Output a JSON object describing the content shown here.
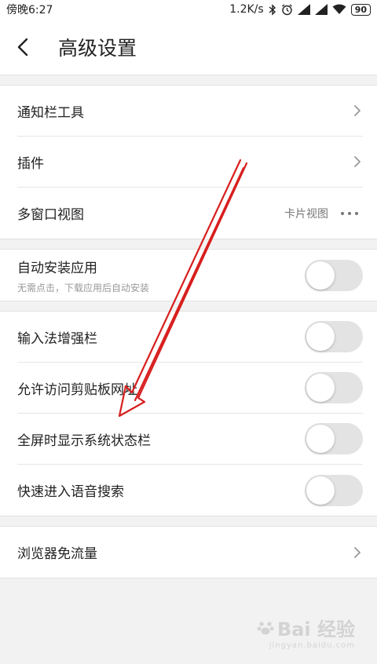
{
  "status_bar": {
    "time": "傍晚6:27",
    "speed": "1.2K/s",
    "battery": "90"
  },
  "header": {
    "title": "高级设置"
  },
  "groups": [
    {
      "items": [
        {
          "label": "通知栏工具",
          "type": "chevron"
        },
        {
          "label": "插件",
          "type": "chevron"
        },
        {
          "label": "多窗口视图",
          "type": "value-more",
          "value": "卡片视图"
        }
      ]
    },
    {
      "items": [
        {
          "label": "自动安装应用",
          "sublabel": "无需点击，下载应用后自动安装",
          "type": "toggle",
          "on": false
        }
      ]
    },
    {
      "items": [
        {
          "label": "输入法增强栏",
          "type": "toggle",
          "on": false
        },
        {
          "label": "允许访问剪贴板网址",
          "type": "toggle",
          "on": false
        },
        {
          "label": "全屏时显示系统状态栏",
          "type": "toggle",
          "on": false
        },
        {
          "label": "快速进入语音搜索",
          "type": "toggle",
          "on": false
        }
      ]
    },
    {
      "items": [
        {
          "label": "浏览器免流量",
          "type": "chevron"
        }
      ]
    }
  ],
  "watermark": {
    "brand": "Bai 经验",
    "url": "jingyan.baidu.com"
  },
  "colors": {
    "annotation_arrow": "#d81e1e",
    "toggle_off": "#e3e3e3"
  },
  "icons": {
    "back": "chevron-left-icon",
    "chevron": "chevron-right-icon",
    "more": "more-horizontal-icon"
  }
}
